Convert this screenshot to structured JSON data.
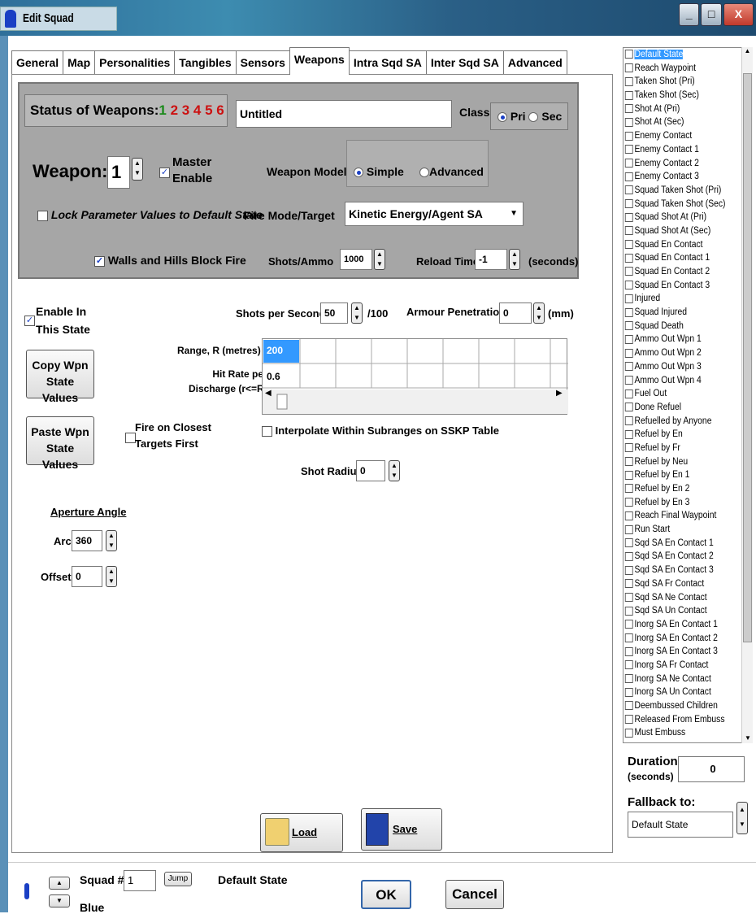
{
  "window": {
    "title": "Edit Squad Properties",
    "min": "_",
    "max": "□",
    "close": "X"
  },
  "tabs": [
    "General",
    "Map",
    "Personalities",
    "Tangibles",
    "Sensors",
    "Weapons",
    "Intra Sqd SA",
    "Inter Sqd SA",
    "Advanced"
  ],
  "status": {
    "label": "Status of Weapons:",
    "n1": "1",
    "rest": "2 3 4 5 6"
  },
  "name": "Untitled",
  "class": {
    "label": "Class",
    "pri": "Pri",
    "sec": "Sec"
  },
  "weapon": {
    "label": "Weapon:",
    "num": "1",
    "master": "Master",
    "enable": "Enable",
    "model_label": "Weapon Model",
    "simple": "Simple",
    "advanced": "Advanced"
  },
  "lock": "Lock Parameter Values to Default State",
  "fire_mode": {
    "label": "Fire Mode/Target",
    "value": "Kinetic Energy/Agent SA"
  },
  "walls": "Walls and Hills Block Fire",
  "shots_ammo": {
    "label": "Shots/Ammo",
    "value": "1000"
  },
  "reload": {
    "label": "Reload Time",
    "value": "-1",
    "unit": "(seconds)"
  },
  "enable_in": [
    "Enable In",
    "This State"
  ],
  "sps": {
    "label": "Shots per Second",
    "value": "50",
    "unit": "/100"
  },
  "armour": {
    "label": "Armour Penetration",
    "value": "0",
    "unit": "(mm)"
  },
  "range": {
    "label": "Range, R (metres)",
    "value": "200"
  },
  "hit": {
    "label1": "Hit Rate per",
    "label2": "Discharge (r<=R)",
    "value": "0.6"
  },
  "copy": [
    "Copy Wpn",
    "State Values"
  ],
  "paste": [
    "Paste Wpn",
    "State Values"
  ],
  "closest": [
    "Fire on Closest",
    "Targets First"
  ],
  "interp": "Interpolate Within Subranges on SSKP Table",
  "shot_radius": {
    "label": "Shot Radius",
    "value": "0"
  },
  "aperture": {
    "title": "Aperture Angle",
    "arc_label": "Arc:",
    "arc": "360",
    "offset_label": "Offset:",
    "offset": "0"
  },
  "load": "Load Wpn",
  "save": "Save Wpn",
  "states": [
    "Default State",
    "Reach Waypoint",
    "Taken Shot (Pri)",
    "Taken Shot (Sec)",
    "Shot At (Pri)",
    "Shot At (Sec)",
    "Enemy Contact",
    "Enemy Contact 1",
    "Enemy Contact 2",
    "Enemy Contact 3",
    "Squad Taken Shot (Pri)",
    "Squad Taken Shot (Sec)",
    "Squad Shot At (Pri)",
    "Squad Shot At (Sec)",
    "Squad En Contact",
    "Squad En Contact 1",
    "Squad En Contact 2",
    "Squad En Contact 3",
    "Injured",
    "Squad Injured",
    "Squad Death",
    "Ammo Out Wpn 1",
    "Ammo Out Wpn 2",
    "Ammo Out Wpn 3",
    "Ammo Out Wpn 4",
    "Fuel Out",
    "Done Refuel",
    "Refuelled by Anyone",
    "Refuel by En",
    "Refuel by Fr",
    "Refuel by Neu",
    "Refuel by En 1",
    "Refuel by En 2",
    "Refuel by En 3",
    "Reach Final Waypoint",
    "Run Start",
    "Sqd SA En Contact 1",
    "Sqd SA En Contact 2",
    "Sqd SA En Contact 3",
    "Sqd SA Fr Contact",
    "Sqd SA Ne Contact",
    "Sqd SA Un Contact",
    "Inorg SA En Contact 1",
    "Inorg SA En Contact 2",
    "Inorg SA En Contact 3",
    "Inorg SA Fr Contact",
    "Inorg SA Ne Contact",
    "Inorg SA Un Contact",
    "Deembussed Children",
    "Released From Embuss",
    "Must Embuss"
  ],
  "duration": {
    "label1": "Duration:",
    "label2": "(seconds)",
    "value": "0"
  },
  "fallback": {
    "label": "Fallback to:",
    "value": "Default State"
  },
  "footer": {
    "squad_label": "Squad #",
    "squad": "1",
    "jump": "Jump",
    "state": "Default State",
    "side": "Blue",
    "ok": "OK",
    "cancel": "Cancel"
  },
  "colors": {
    "green": "#1a8a1a",
    "red": "#cc1111",
    "select": "#3399ff"
  }
}
